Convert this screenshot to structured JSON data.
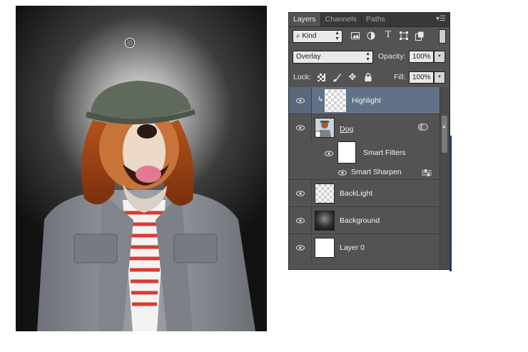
{
  "panel": {
    "tabs": [
      {
        "label": "Layers",
        "active": true
      },
      {
        "label": "Channels",
        "active": false
      },
      {
        "label": "Paths",
        "active": false
      }
    ],
    "menu_icon": "panel-menu-icon",
    "filter": {
      "kind_label": "Kind",
      "icons": [
        "image-filter-icon",
        "adjustment-filter-icon",
        "type-filter-icon",
        "shape-filter-icon",
        "smart-object-filter-icon"
      ]
    },
    "blend_mode": "Overlay",
    "opacity": {
      "label": "Opacity:",
      "value": "100%"
    },
    "lock": {
      "label": "Lock:",
      "icons": [
        "lock-transparent-icon",
        "lock-image-icon",
        "lock-position-icon",
        "lock-all-icon"
      ]
    },
    "fill": {
      "label": "Fill:",
      "value": "100%"
    },
    "layers": [
      {
        "name": "Highlight",
        "selected": true,
        "visible": true,
        "clipped": true,
        "thumb": "transparent"
      },
      {
        "name": "Dog",
        "selected": false,
        "visible": true,
        "smart_object": true,
        "thumb": "dog"
      },
      {
        "name": "Smart Filters",
        "sub": true,
        "visible": true,
        "thumb": "white"
      },
      {
        "name": "Smart Sharpen",
        "filter": true,
        "visible": true
      },
      {
        "name": "BackLight",
        "selected": false,
        "visible": true,
        "thumb": "transparent"
      },
      {
        "name": "Background",
        "selected": false,
        "visible": true,
        "thumb": "dark-gradient"
      },
      {
        "name": "Layer 0",
        "selected": false,
        "visible": true,
        "thumb": "white"
      }
    ]
  },
  "colors": {
    "selected_row": "#617187",
    "panel_bg": "#535353",
    "tab_bar": "#393939"
  }
}
